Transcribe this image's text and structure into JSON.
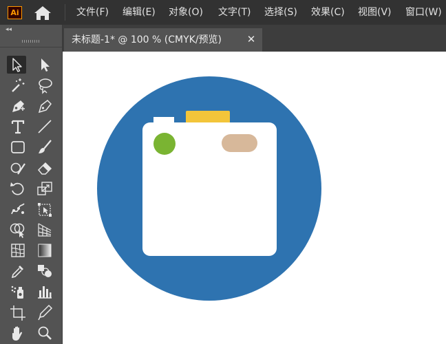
{
  "app": {
    "logo_text": "Ai",
    "brand_color": "#ff9a00",
    "home_icon": "home-icon"
  },
  "menu": [
    {
      "label": "文件(F)"
    },
    {
      "label": "编辑(E)"
    },
    {
      "label": "对象(O)"
    },
    {
      "label": "文字(T)"
    },
    {
      "label": "选择(S)"
    },
    {
      "label": "效果(C)"
    },
    {
      "label": "视图(V)"
    },
    {
      "label": "窗口(W)"
    }
  ],
  "toolbar": {
    "collapse_label": "◂◂",
    "tools": [
      {
        "name": "selection-tool-icon",
        "active": true
      },
      {
        "name": "direct-selection-tool-icon"
      },
      {
        "name": "magic-wand-tool-icon"
      },
      {
        "name": "lasso-tool-icon"
      },
      {
        "name": "pen-tool-icon"
      },
      {
        "name": "curvature-tool-icon"
      },
      {
        "name": "type-tool-icon"
      },
      {
        "name": "line-segment-tool-icon"
      },
      {
        "name": "rectangle-tool-icon"
      },
      {
        "name": "paintbrush-tool-icon"
      },
      {
        "name": "shaper-tool-icon"
      },
      {
        "name": "eraser-tool-icon"
      },
      {
        "name": "rotate-tool-icon"
      },
      {
        "name": "scale-tool-icon"
      },
      {
        "name": "puppet-warp-tool-icon"
      },
      {
        "name": "free-transform-tool-icon"
      },
      {
        "name": "shape-builder-tool-icon"
      },
      {
        "name": "perspective-grid-tool-icon"
      },
      {
        "name": "mesh-tool-icon"
      },
      {
        "name": "gradient-tool-icon"
      },
      {
        "name": "eyedropper-tool-icon"
      },
      {
        "name": "blend-tool-icon"
      },
      {
        "name": "symbol-sprayer-tool-icon"
      },
      {
        "name": "column-graph-tool-icon"
      },
      {
        "name": "artboard-tool-icon"
      },
      {
        "name": "slice-tool-icon"
      },
      {
        "name": "hand-tool-icon"
      },
      {
        "name": "zoom-tool-icon"
      }
    ]
  },
  "document": {
    "tab_title": "未标题-1* @ 100 % (CMYK/预览)",
    "close_label": "✕"
  },
  "artwork": {
    "colors": {
      "circle": "#2e73b0",
      "body": "#ffffff",
      "flash": "#f3c53a",
      "lens_dot": "#7ab432",
      "pill": "#d7b89a"
    }
  }
}
